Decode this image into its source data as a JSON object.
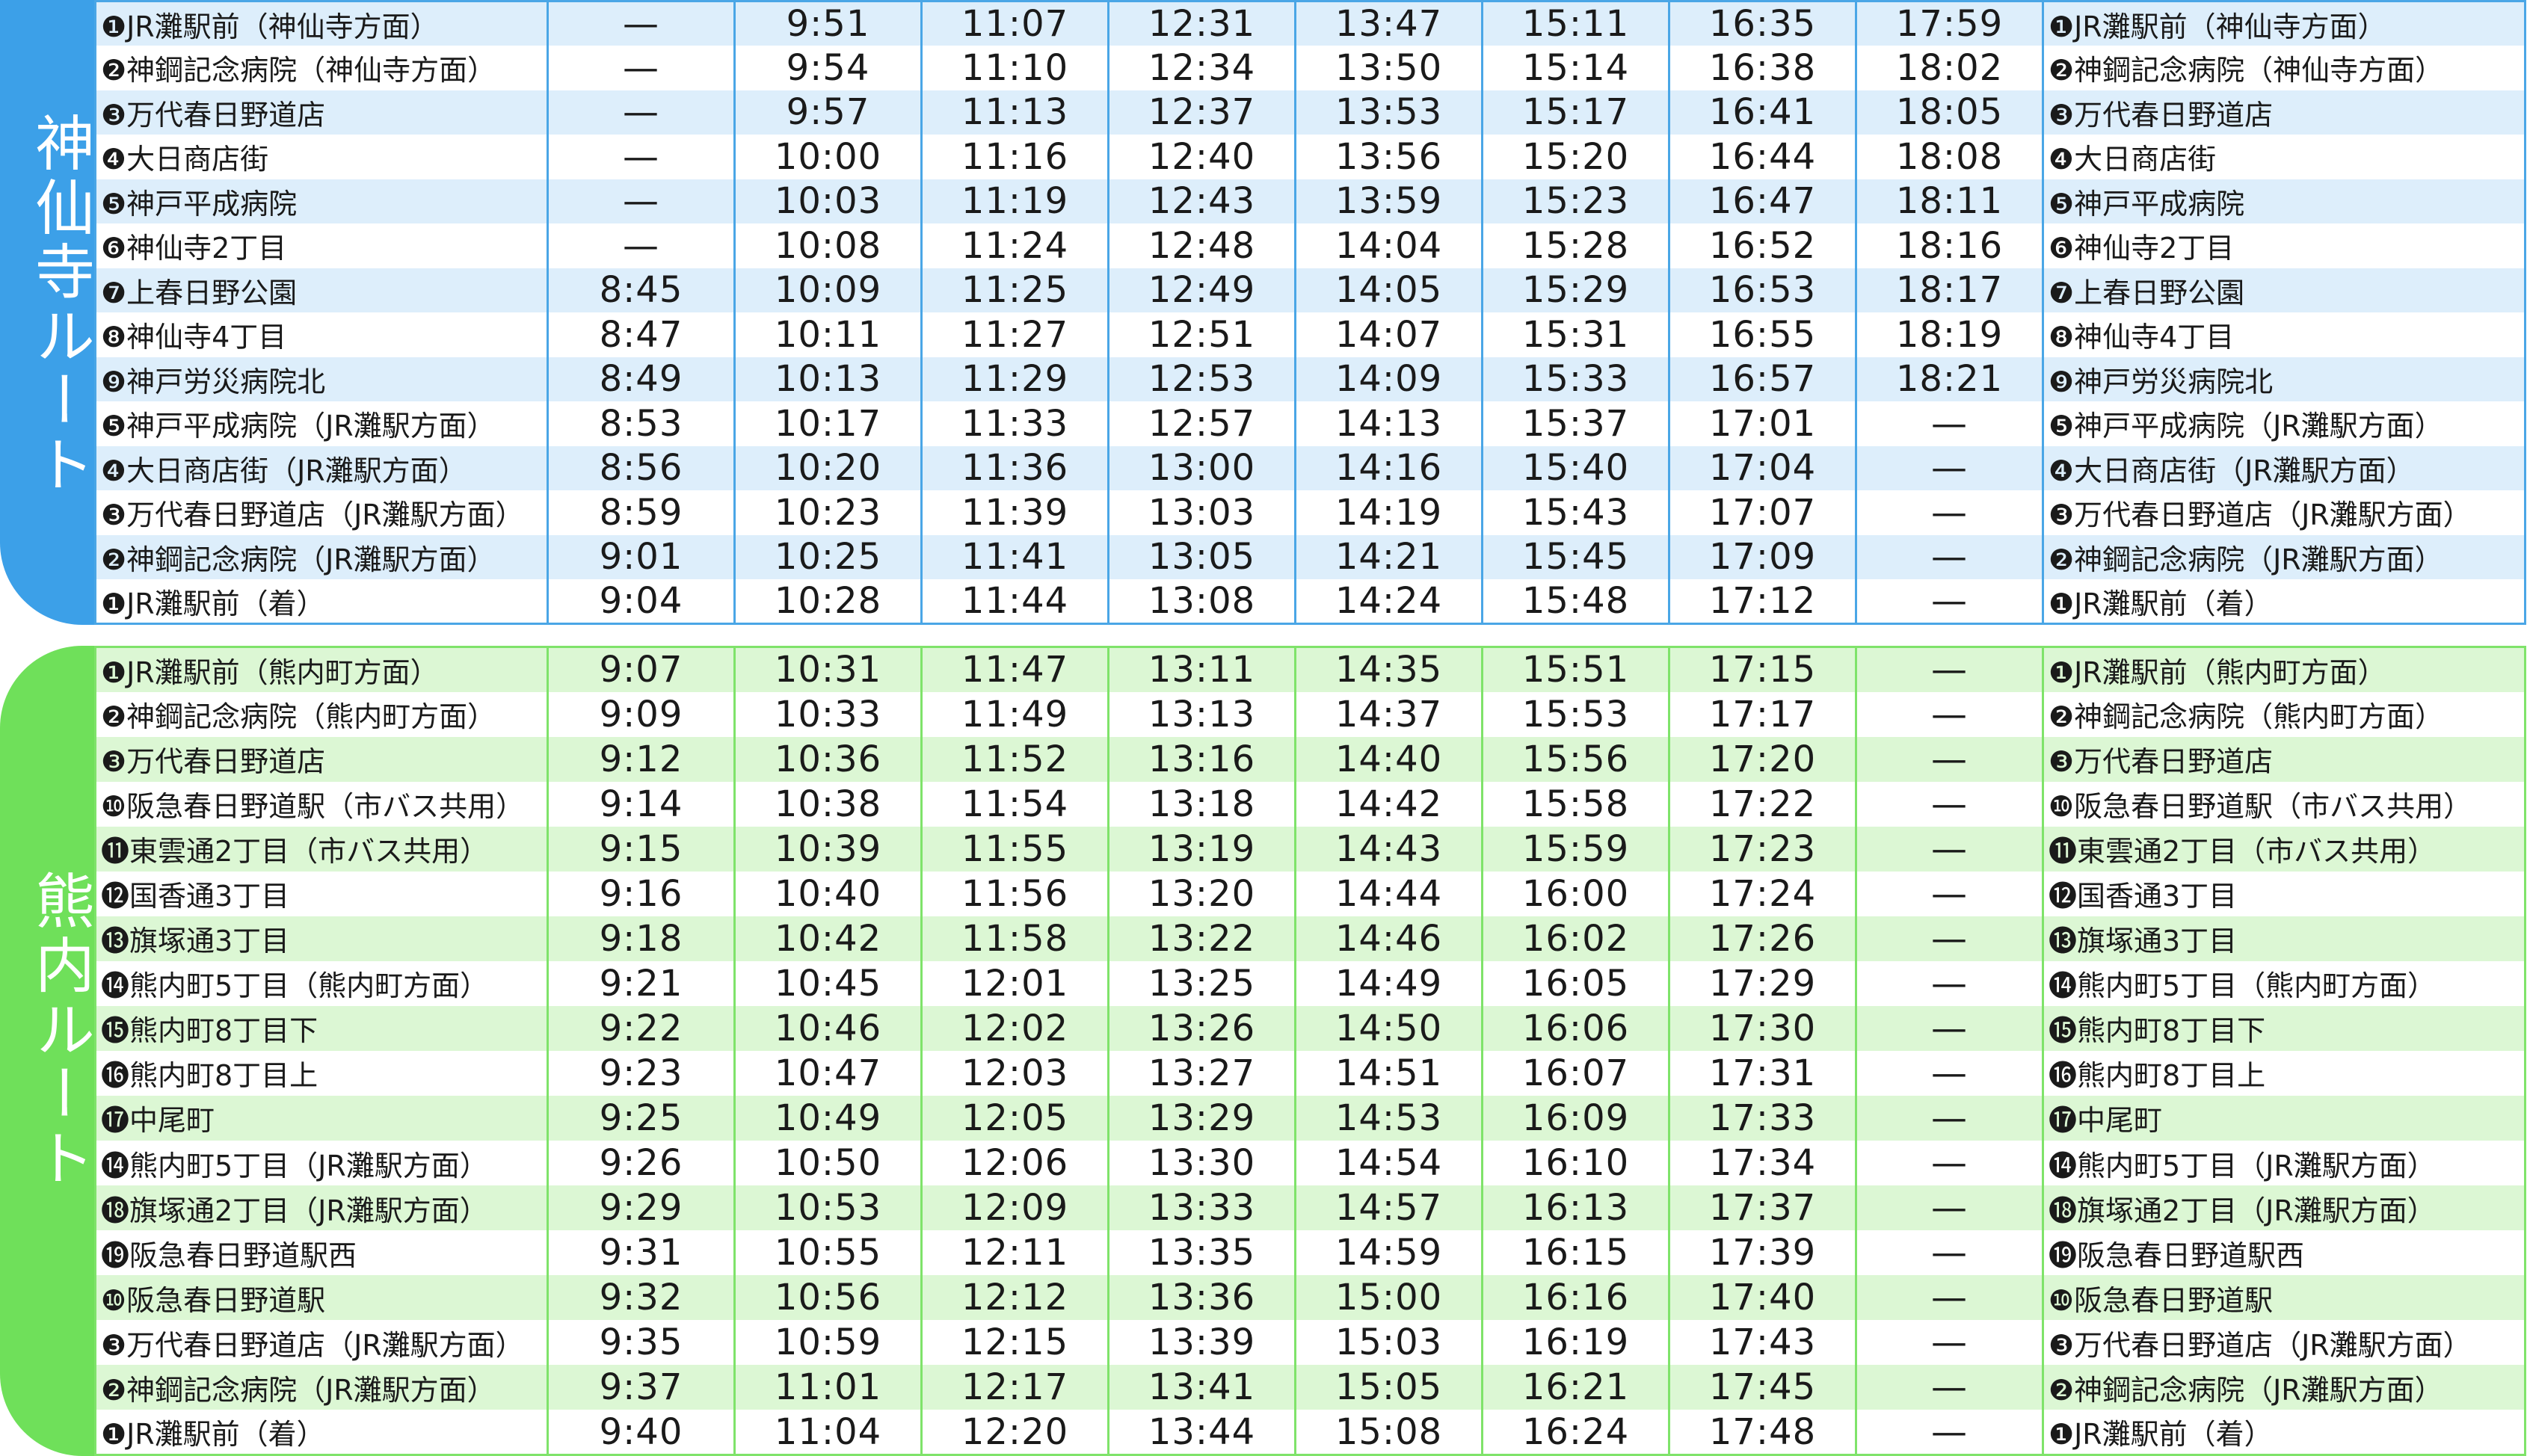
{
  "colors": {
    "route1": "#3ca0e8",
    "route1_alt": "#ddeefb",
    "route2": "#6fe05a",
    "route2_alt": "#dcf7d4"
  },
  "routes": [
    {
      "name": "神仙寺ルート",
      "rows": [
        [
          "❶JR灘駅前（神仙寺方面）",
          "—",
          "9:51",
          "11:07",
          "12:31",
          "13:47",
          "15:11",
          "16:35",
          "17:59",
          "❶JR灘駅前（神仙寺方面）"
        ],
        [
          "❷神鋼記念病院（神仙寺方面）",
          "—",
          "9:54",
          "11:10",
          "12:34",
          "13:50",
          "15:14",
          "16:38",
          "18:02",
          "❷神鋼記念病院（神仙寺方面）"
        ],
        [
          "❸万代春日野道店",
          "—",
          "9:57",
          "11:13",
          "12:37",
          "13:53",
          "15:17",
          "16:41",
          "18:05",
          "❸万代春日野道店"
        ],
        [
          "❹大日商店街",
          "—",
          "10:00",
          "11:16",
          "12:40",
          "13:56",
          "15:20",
          "16:44",
          "18:08",
          "❹大日商店街"
        ],
        [
          "❺神戸平成病院",
          "—",
          "10:03",
          "11:19",
          "12:43",
          "13:59",
          "15:23",
          "16:47",
          "18:11",
          "❺神戸平成病院"
        ],
        [
          "❻神仙寺2丁目",
          "—",
          "10:08",
          "11:24",
          "12:48",
          "14:04",
          "15:28",
          "16:52",
          "18:16",
          "❻神仙寺2丁目"
        ],
        [
          "❼上春日野公園",
          "8:45",
          "10:09",
          "11:25",
          "12:49",
          "14:05",
          "15:29",
          "16:53",
          "18:17",
          "❼上春日野公園"
        ],
        [
          "❽神仙寺4丁目",
          "8:47",
          "10:11",
          "11:27",
          "12:51",
          "14:07",
          "15:31",
          "16:55",
          "18:19",
          "❽神仙寺4丁目"
        ],
        [
          "❾神戸労災病院北",
          "8:49",
          "10:13",
          "11:29",
          "12:53",
          "14:09",
          "15:33",
          "16:57",
          "18:21",
          "❾神戸労災病院北"
        ],
        [
          "❺神戸平成病院（JR灘駅方面）",
          "8:53",
          "10:17",
          "11:33",
          "12:57",
          "14:13",
          "15:37",
          "17:01",
          "—",
          "❺神戸平成病院（JR灘駅方面）"
        ],
        [
          "❹大日商店街（JR灘駅方面）",
          "8:56",
          "10:20",
          "11:36",
          "13:00",
          "14:16",
          "15:40",
          "17:04",
          "—",
          "❹大日商店街（JR灘駅方面）"
        ],
        [
          "❸万代春日野道店（JR灘駅方面）",
          "8:59",
          "10:23",
          "11:39",
          "13:03",
          "14:19",
          "15:43",
          "17:07",
          "—",
          "❸万代春日野道店（JR灘駅方面）"
        ],
        [
          "❷神鋼記念病院（JR灘駅方面）",
          "9:01",
          "10:25",
          "11:41",
          "13:05",
          "14:21",
          "15:45",
          "17:09",
          "—",
          "❷神鋼記念病院（JR灘駅方面）"
        ],
        [
          "❶JR灘駅前（着）",
          "9:04",
          "10:28",
          "11:44",
          "13:08",
          "14:24",
          "15:48",
          "17:12",
          "—",
          "❶JR灘駅前（着）"
        ]
      ]
    },
    {
      "name": "熊内ルート",
      "rows": [
        [
          "❶JR灘駅前（熊内町方面）",
          "9:07",
          "10:31",
          "11:47",
          "13:11",
          "14:35",
          "15:51",
          "17:15",
          "—",
          "❶JR灘駅前（熊内町方面）"
        ],
        [
          "❷神鋼記念病院（熊内町方面）",
          "9:09",
          "10:33",
          "11:49",
          "13:13",
          "14:37",
          "15:53",
          "17:17",
          "—",
          "❷神鋼記念病院（熊内町方面）"
        ],
        [
          "❸万代春日野道店",
          "9:12",
          "10:36",
          "11:52",
          "13:16",
          "14:40",
          "15:56",
          "17:20",
          "—",
          "❸万代春日野道店"
        ],
        [
          "❿阪急春日野道駅（市バス共用）",
          "9:14",
          "10:38",
          "11:54",
          "13:18",
          "14:42",
          "15:58",
          "17:22",
          "—",
          "❿阪急春日野道駅（市バス共用）"
        ],
        [
          "⓫東雲通2丁目（市バス共用）",
          "9:15",
          "10:39",
          "11:55",
          "13:19",
          "14:43",
          "15:59",
          "17:23",
          "—",
          "⓫東雲通2丁目（市バス共用）"
        ],
        [
          "⓬国香通3丁目",
          "9:16",
          "10:40",
          "11:56",
          "13:20",
          "14:44",
          "16:00",
          "17:24",
          "—",
          "⓬国香通3丁目"
        ],
        [
          "⓭旗塚通3丁目",
          "9:18",
          "10:42",
          "11:58",
          "13:22",
          "14:46",
          "16:02",
          "17:26",
          "—",
          "⓭旗塚通3丁目"
        ],
        [
          "⓮熊内町5丁目（熊内町方面）",
          "9:21",
          "10:45",
          "12:01",
          "13:25",
          "14:49",
          "16:05",
          "17:29",
          "—",
          "⓮熊内町5丁目（熊内町方面）"
        ],
        [
          "⓯熊内町8丁目下",
          "9:22",
          "10:46",
          "12:02",
          "13:26",
          "14:50",
          "16:06",
          "17:30",
          "—",
          "⓯熊内町8丁目下"
        ],
        [
          "⓰熊内町8丁目上",
          "9:23",
          "10:47",
          "12:03",
          "13:27",
          "14:51",
          "16:07",
          "17:31",
          "—",
          "⓰熊内町8丁目上"
        ],
        [
          "⓱中尾町",
          "9:25",
          "10:49",
          "12:05",
          "13:29",
          "14:53",
          "16:09",
          "17:33",
          "—",
          "⓱中尾町"
        ],
        [
          "⓮熊内町5丁目（JR灘駅方面）",
          "9:26",
          "10:50",
          "12:06",
          "13:30",
          "14:54",
          "16:10",
          "17:34",
          "—",
          "⓮熊内町5丁目（JR灘駅方面）"
        ],
        [
          "⓲旗塚通2丁目（JR灘駅方面）",
          "9:29",
          "10:53",
          "12:09",
          "13:33",
          "14:57",
          "16:13",
          "17:37",
          "—",
          "⓲旗塚通2丁目（JR灘駅方面）"
        ],
        [
          "⓳阪急春日野道駅西",
          "9:31",
          "10:55",
          "12:11",
          "13:35",
          "14:59",
          "16:15",
          "17:39",
          "—",
          "⓳阪急春日野道駅西"
        ],
        [
          "❿阪急春日野道駅",
          "9:32",
          "10:56",
          "12:12",
          "13:36",
          "15:00",
          "16:16",
          "17:40",
          "—",
          "❿阪急春日野道駅"
        ],
        [
          "❸万代春日野道店（JR灘駅方面）",
          "9:35",
          "10:59",
          "12:15",
          "13:39",
          "15:03",
          "16:19",
          "17:43",
          "—",
          "❸万代春日野道店（JR灘駅方面）"
        ],
        [
          "❷神鋼記念病院（JR灘駅方面）",
          "9:37",
          "11:01",
          "12:17",
          "13:41",
          "15:05",
          "16:21",
          "17:45",
          "—",
          "❷神鋼記念病院（JR灘駅方面）"
        ],
        [
          "❶JR灘駅前（着）",
          "9:40",
          "11:04",
          "12:20",
          "13:44",
          "15:08",
          "16:24",
          "17:48",
          "—",
          "❶JR灘駅前（着）"
        ]
      ]
    }
  ]
}
